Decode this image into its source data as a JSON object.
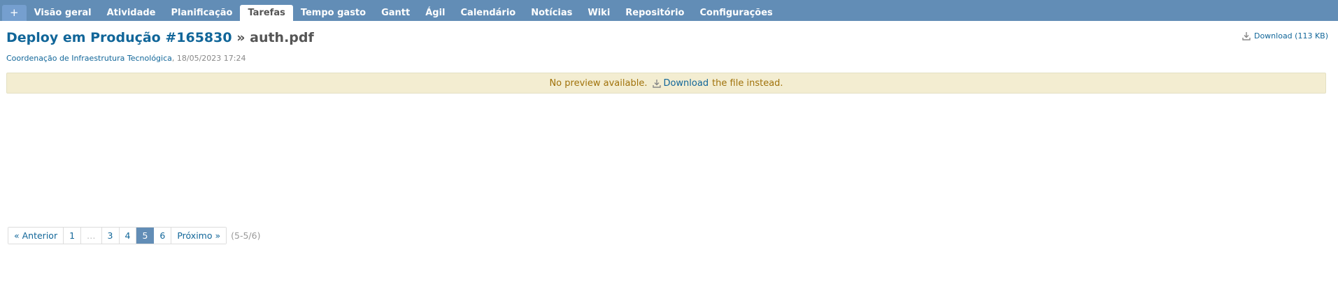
{
  "nav": {
    "new_label": "+",
    "tabs": [
      {
        "label": "Visão geral",
        "selected": false
      },
      {
        "label": "Atividade",
        "selected": false
      },
      {
        "label": "Planificação",
        "selected": false
      },
      {
        "label": "Tarefas",
        "selected": true
      },
      {
        "label": "Tempo gasto",
        "selected": false
      },
      {
        "label": "Gantt",
        "selected": false
      },
      {
        "label": "Ágil",
        "selected": false
      },
      {
        "label": "Calendário",
        "selected": false
      },
      {
        "label": "Notícias",
        "selected": false
      },
      {
        "label": "Wiki",
        "selected": false
      },
      {
        "label": "Repositório",
        "selected": false
      },
      {
        "label": "Configurações",
        "selected": false
      }
    ]
  },
  "header": {
    "issue_link": "Deploy em Produção #165830",
    "separator": "»",
    "filename": "auth.pdf",
    "download_label": "Download (113 KB)"
  },
  "meta": {
    "author": "Coordenação de Infraestrutura Tecnológica",
    "date": ", 18/05/2023 17:24"
  },
  "notice": {
    "prefix": "No preview available.",
    "link": "Download",
    "suffix": "the file instead."
  },
  "pagination": {
    "previous": "« Anterior",
    "pages": [
      "1",
      "…",
      "3",
      "4",
      "5",
      "6"
    ],
    "current": "5",
    "next": "Próximo »",
    "count": "(5-5/6)"
  },
  "colors": {
    "topbar": "#628db6",
    "link": "#116699",
    "flash_bg": "#f3edd1",
    "flash_text": "#a0720b"
  }
}
